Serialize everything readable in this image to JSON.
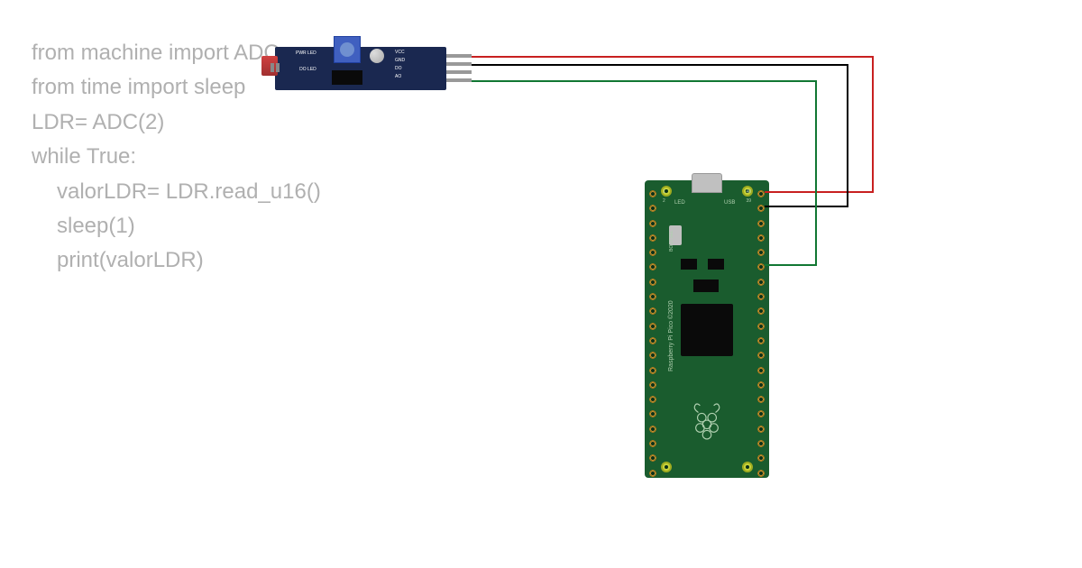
{
  "code": {
    "line1": "from machine import ADC",
    "line2": "from time import sleep",
    "line3": "LDR= ADC(2)",
    "line4": "while True:",
    "line5": "valorLDR= LDR.read_u16()",
    "line6": "sleep(1)",
    "line7": "print(valorLDR)"
  },
  "ldr_module": {
    "pin_labels": [
      "VCC",
      "GND",
      "DO",
      "AO"
    ],
    "side_labels": [
      "PWR\nLED",
      "DO\nLED"
    ],
    "plus": "+"
  },
  "pico": {
    "board_text": "Raspberry Pi Pico ©2020",
    "led_label": "LED",
    "usb_label": "USB",
    "bootsel_label": "BOOTSEL",
    "pin1": "1",
    "pin2": "2",
    "pin39": "39",
    "pin40": "40"
  },
  "wiring": {
    "vcc_color": "#c82020",
    "gnd_color": "#000000",
    "signal_color": "#117733"
  }
}
